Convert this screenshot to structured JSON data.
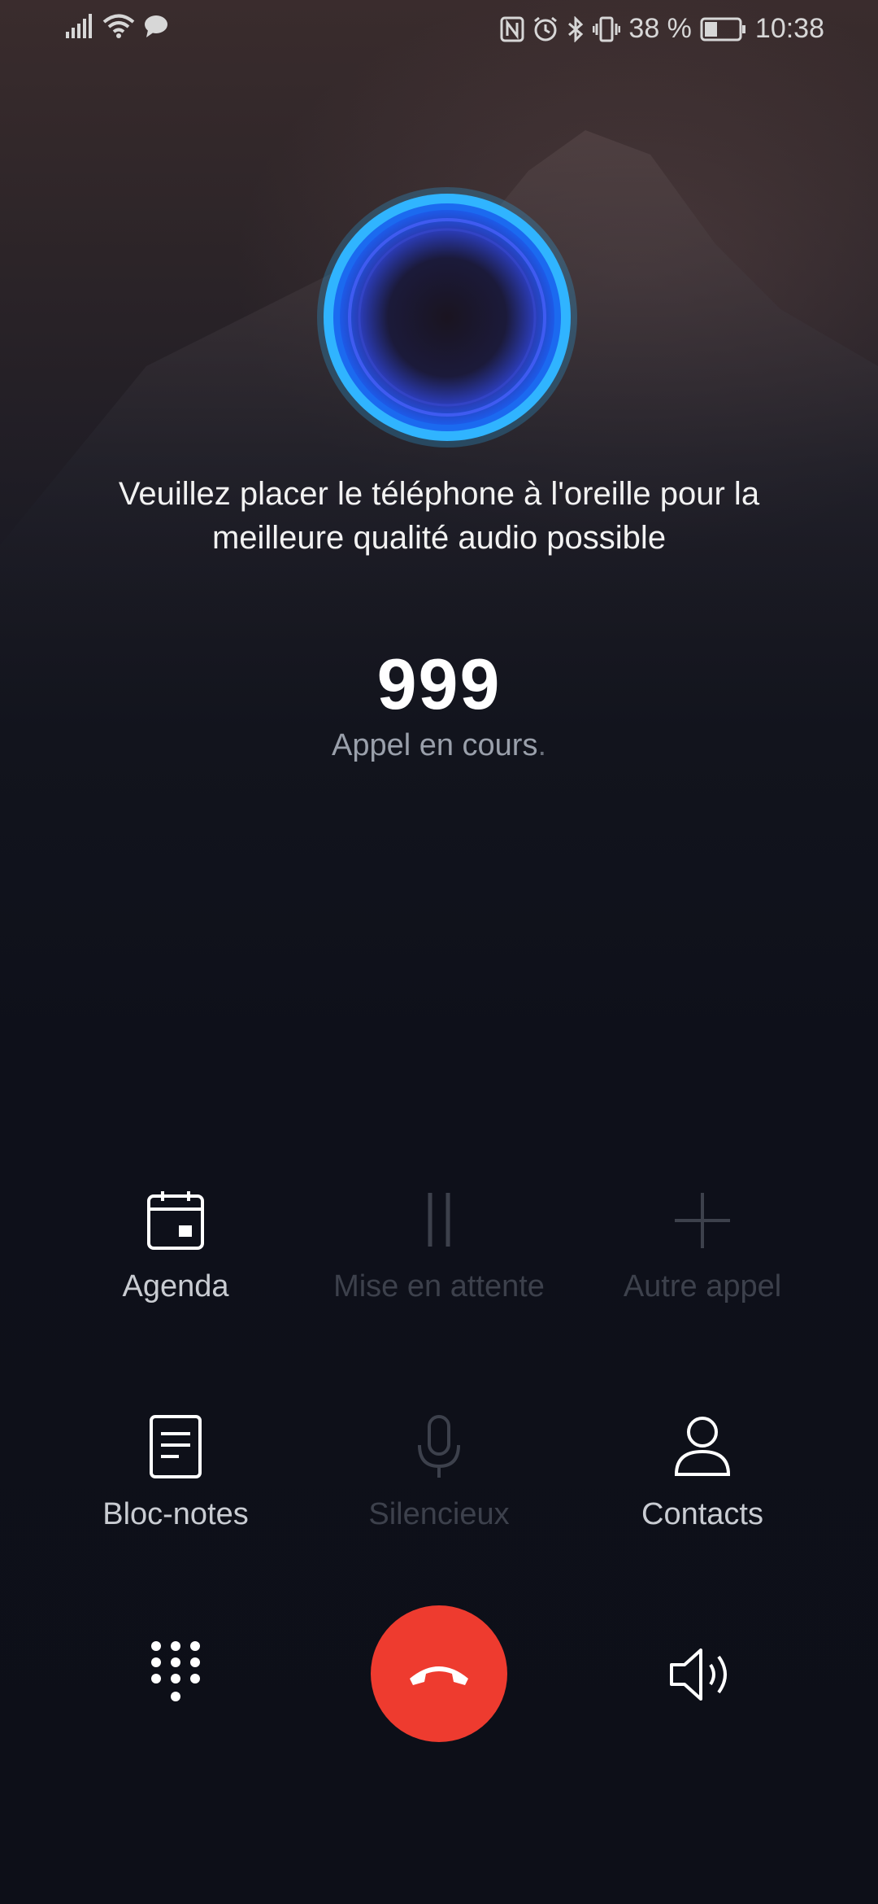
{
  "status_bar": {
    "icons_left": [
      "signal-icon",
      "wifi-icon",
      "message-icon"
    ],
    "icons_right": [
      "nfc-icon",
      "alarm-icon",
      "bluetooth-icon",
      "vibrate-icon"
    ],
    "battery": "38 %",
    "battery_level": 0.38,
    "time": "10:38"
  },
  "call": {
    "hint": "Veuillez placer le téléphone à l'oreille pour la meilleure qualité audio possible",
    "number": "999",
    "status": "Appel en cours",
    "status_dot": "."
  },
  "actions": {
    "agenda": "Agenda",
    "hold": "Mise en attente",
    "add_call": "Autre appel",
    "notes": "Bloc-notes",
    "mute": "Silencieux",
    "contacts": "Contacts"
  },
  "colors": {
    "end_call": "#ee3b2f",
    "orb": "#2ab8ff"
  }
}
